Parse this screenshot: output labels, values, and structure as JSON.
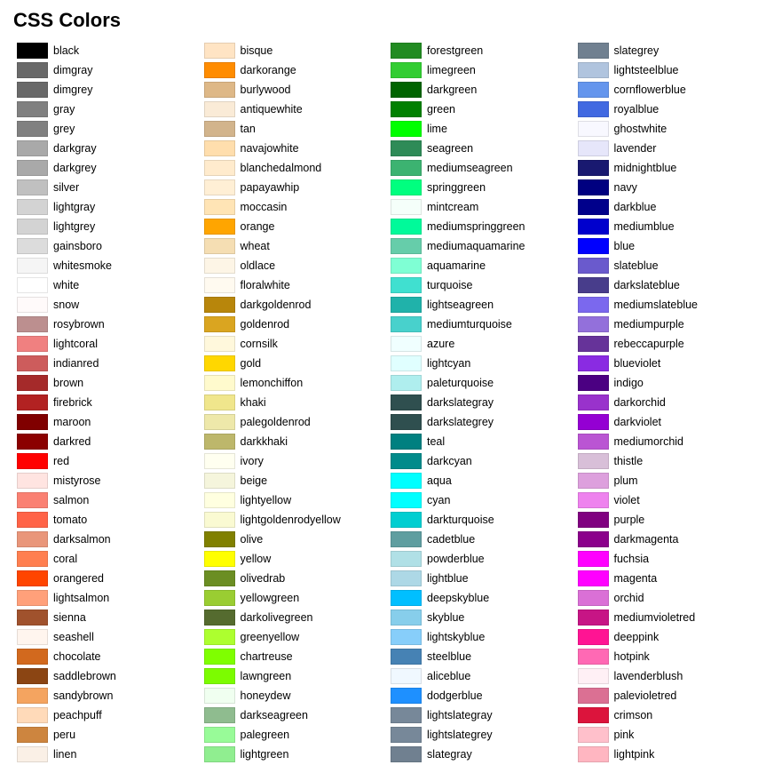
{
  "title": "CSS Colors",
  "colors": [
    {
      "name": "black",
      "hex": "#000000"
    },
    {
      "name": "dimgray",
      "hex": "#696969"
    },
    {
      "name": "dimgrey",
      "hex": "#696969"
    },
    {
      "name": "gray",
      "hex": "#808080"
    },
    {
      "name": "grey",
      "hex": "#808080"
    },
    {
      "name": "darkgray",
      "hex": "#a9a9a9"
    },
    {
      "name": "darkgrey",
      "hex": "#a9a9a9"
    },
    {
      "name": "silver",
      "hex": "#c0c0c0"
    },
    {
      "name": "lightgray",
      "hex": "#d3d3d3"
    },
    {
      "name": "lightgrey",
      "hex": "#d3d3d3"
    },
    {
      "name": "gainsboro",
      "hex": "#dcdcdc"
    },
    {
      "name": "whitesmoke",
      "hex": "#f5f5f5"
    },
    {
      "name": "white",
      "hex": "#ffffff"
    },
    {
      "name": "snow",
      "hex": "#fffafa"
    },
    {
      "name": "rosybrown",
      "hex": "#bc8f8f"
    },
    {
      "name": "lightcoral",
      "hex": "#f08080"
    },
    {
      "name": "indianred",
      "hex": "#cd5c5c"
    },
    {
      "name": "brown",
      "hex": "#a52a2a"
    },
    {
      "name": "firebrick",
      "hex": "#b22222"
    },
    {
      "name": "maroon",
      "hex": "#800000"
    },
    {
      "name": "darkred",
      "hex": "#8b0000"
    },
    {
      "name": "red",
      "hex": "#ff0000"
    },
    {
      "name": "mistyrose",
      "hex": "#ffe4e1"
    },
    {
      "name": "salmon",
      "hex": "#fa8072"
    },
    {
      "name": "tomato",
      "hex": "#ff6347"
    },
    {
      "name": "darksalmon",
      "hex": "#e9967a"
    },
    {
      "name": "coral",
      "hex": "#ff7f50"
    },
    {
      "name": "orangered",
      "hex": "#ff4500"
    },
    {
      "name": "lightsalmon",
      "hex": "#ffa07a"
    },
    {
      "name": "sienna",
      "hex": "#a0522d"
    },
    {
      "name": "seashell",
      "hex": "#fff5ee"
    },
    {
      "name": "chocolate",
      "hex": "#d2691e"
    },
    {
      "name": "saddlebrown",
      "hex": "#8b4513"
    },
    {
      "name": "sandybrown",
      "hex": "#f4a460"
    },
    {
      "name": "peachpuff",
      "hex": "#ffdab9"
    },
    {
      "name": "peru",
      "hex": "#cd853f"
    },
    {
      "name": "linen",
      "hex": "#faf0e6"
    },
    {
      "name": "bisque",
      "hex": "#ffe4c4"
    },
    {
      "name": "darkorange",
      "hex": "#ff8c00"
    },
    {
      "name": "burlywood",
      "hex": "#deb887"
    },
    {
      "name": "antiquewhite",
      "hex": "#faebd7"
    },
    {
      "name": "tan",
      "hex": "#d2b48c"
    },
    {
      "name": "navajowhite",
      "hex": "#ffdead"
    },
    {
      "name": "blanchedalmond",
      "hex": "#ffebcd"
    },
    {
      "name": "papayawhip",
      "hex": "#ffefd5"
    },
    {
      "name": "moccasin",
      "hex": "#ffe4b5"
    },
    {
      "name": "orange",
      "hex": "#ffa500"
    },
    {
      "name": "wheat",
      "hex": "#f5deb3"
    },
    {
      "name": "oldlace",
      "hex": "#fdf5e6"
    },
    {
      "name": "floralwhite",
      "hex": "#fffaf0"
    },
    {
      "name": "darkgoldenrod",
      "hex": "#b8860b"
    },
    {
      "name": "goldenrod",
      "hex": "#daa520"
    },
    {
      "name": "cornsilk",
      "hex": "#fff8dc"
    },
    {
      "name": "gold",
      "hex": "#ffd700"
    },
    {
      "name": "lemonchiffon",
      "hex": "#fffacd"
    },
    {
      "name": "khaki",
      "hex": "#f0e68c"
    },
    {
      "name": "palegoldenrod",
      "hex": "#eee8aa"
    },
    {
      "name": "darkkhaki",
      "hex": "#bdb76b"
    },
    {
      "name": "ivory",
      "hex": "#fffff0"
    },
    {
      "name": "beige",
      "hex": "#f5f5dc"
    },
    {
      "name": "lightyellow",
      "hex": "#ffffe0"
    },
    {
      "name": "lightgoldenrodyellow",
      "hex": "#fafad2"
    },
    {
      "name": "olive",
      "hex": "#808000"
    },
    {
      "name": "yellow",
      "hex": "#ffff00"
    },
    {
      "name": "olivedrab",
      "hex": "#6b8e23"
    },
    {
      "name": "yellowgreen",
      "hex": "#9acd32"
    },
    {
      "name": "darkolivegreen",
      "hex": "#556b2f"
    },
    {
      "name": "greenyellow",
      "hex": "#adff2f"
    },
    {
      "name": "chartreuse",
      "hex": "#7fff00"
    },
    {
      "name": "lawngreen",
      "hex": "#7cfc00"
    },
    {
      "name": "honeydew",
      "hex": "#f0fff0"
    },
    {
      "name": "darkseagreen",
      "hex": "#8fbc8f"
    },
    {
      "name": "palegreen",
      "hex": "#98fb98"
    },
    {
      "name": "lightgreen",
      "hex": "#90ee90"
    },
    {
      "name": "forestgreen",
      "hex": "#228b22"
    },
    {
      "name": "limegreen",
      "hex": "#32cd32"
    },
    {
      "name": "darkgreen",
      "hex": "#006400"
    },
    {
      "name": "green",
      "hex": "#008000"
    },
    {
      "name": "lime",
      "hex": "#00ff00"
    },
    {
      "name": "seagreen",
      "hex": "#2e8b57"
    },
    {
      "name": "mediumseagreen",
      "hex": "#3cb371"
    },
    {
      "name": "springgreen",
      "hex": "#00ff7f"
    },
    {
      "name": "mintcream",
      "hex": "#f5fffa"
    },
    {
      "name": "mediumspringgreen",
      "hex": "#00fa9a"
    },
    {
      "name": "mediumaquamarine",
      "hex": "#66cdaa"
    },
    {
      "name": "aquamarine",
      "hex": "#7fffd4"
    },
    {
      "name": "turquoise",
      "hex": "#40e0d0"
    },
    {
      "name": "lightseagreen",
      "hex": "#20b2aa"
    },
    {
      "name": "mediumturquoise",
      "hex": "#48d1cc"
    },
    {
      "name": "azure",
      "hex": "#f0ffff"
    },
    {
      "name": "lightcyan",
      "hex": "#e0ffff"
    },
    {
      "name": "paleturquoise",
      "hex": "#afeeee"
    },
    {
      "name": "darkslategray",
      "hex": "#2f4f4f"
    },
    {
      "name": "darkslategrey",
      "hex": "#2f4f4f"
    },
    {
      "name": "teal",
      "hex": "#008080"
    },
    {
      "name": "darkcyan",
      "hex": "#008b8b"
    },
    {
      "name": "aqua",
      "hex": "#00ffff"
    },
    {
      "name": "cyan",
      "hex": "#00ffff"
    },
    {
      "name": "darkturquoise",
      "hex": "#00ced1"
    },
    {
      "name": "cadetblue",
      "hex": "#5f9ea0"
    },
    {
      "name": "powderblue",
      "hex": "#b0e0e6"
    },
    {
      "name": "lightblue",
      "hex": "#add8e6"
    },
    {
      "name": "deepskyblue",
      "hex": "#00bfff"
    },
    {
      "name": "skyblue",
      "hex": "#87ceeb"
    },
    {
      "name": "lightskyblue",
      "hex": "#87cefa"
    },
    {
      "name": "steelblue",
      "hex": "#4682b4"
    },
    {
      "name": "aliceblue",
      "hex": "#f0f8ff"
    },
    {
      "name": "dodgerblue",
      "hex": "#1e90ff"
    },
    {
      "name": "lightslategray",
      "hex": "#778899"
    },
    {
      "name": "lightslategrey",
      "hex": "#778899"
    },
    {
      "name": "slategray",
      "hex": "#708090"
    },
    {
      "name": "slategrey",
      "hex": "#708090"
    },
    {
      "name": "lightsteelblue",
      "hex": "#b0c4de"
    },
    {
      "name": "cornflowerblue",
      "hex": "#6495ed"
    },
    {
      "name": "royalblue",
      "hex": "#4169e1"
    },
    {
      "name": "ghostwhite",
      "hex": "#f8f8ff"
    },
    {
      "name": "lavender",
      "hex": "#e6e6fa"
    },
    {
      "name": "midnightblue",
      "hex": "#191970"
    },
    {
      "name": "navy",
      "hex": "#000080"
    },
    {
      "name": "darkblue",
      "hex": "#00008b"
    },
    {
      "name": "mediumblue",
      "hex": "#0000cd"
    },
    {
      "name": "blue",
      "hex": "#0000ff"
    },
    {
      "name": "slateblue",
      "hex": "#6a5acd"
    },
    {
      "name": "darkslateblue",
      "hex": "#483d8b"
    },
    {
      "name": "mediumslateblue",
      "hex": "#7b68ee"
    },
    {
      "name": "mediumpurple",
      "hex": "#9370db"
    },
    {
      "name": "rebeccapurple",
      "hex": "#663399"
    },
    {
      "name": "blueviolet",
      "hex": "#8a2be2"
    },
    {
      "name": "indigo",
      "hex": "#4b0082"
    },
    {
      "name": "darkorchid",
      "hex": "#9932cc"
    },
    {
      "name": "darkviolet",
      "hex": "#9400d3"
    },
    {
      "name": "mediumorchid",
      "hex": "#ba55d3"
    },
    {
      "name": "thistle",
      "hex": "#d8bfd8"
    },
    {
      "name": "plum",
      "hex": "#dda0dd"
    },
    {
      "name": "violet",
      "hex": "#ee82ee"
    },
    {
      "name": "purple",
      "hex": "#800080"
    },
    {
      "name": "darkmagenta",
      "hex": "#8b008b"
    },
    {
      "name": "fuchsia",
      "hex": "#ff00ff"
    },
    {
      "name": "magenta",
      "hex": "#ff00ff"
    },
    {
      "name": "orchid",
      "hex": "#da70d6"
    },
    {
      "name": "mediumvioletred",
      "hex": "#c71585"
    },
    {
      "name": "deeppink",
      "hex": "#ff1493"
    },
    {
      "name": "hotpink",
      "hex": "#ff69b4"
    },
    {
      "name": "lavenderblush",
      "hex": "#fff0f5"
    },
    {
      "name": "palevioletred",
      "hex": "#db7093"
    },
    {
      "name": "crimson",
      "hex": "#dc143c"
    },
    {
      "name": "pink",
      "hex": "#ffc0cb"
    },
    {
      "name": "lightpink",
      "hex": "#ffb6c1"
    }
  ]
}
